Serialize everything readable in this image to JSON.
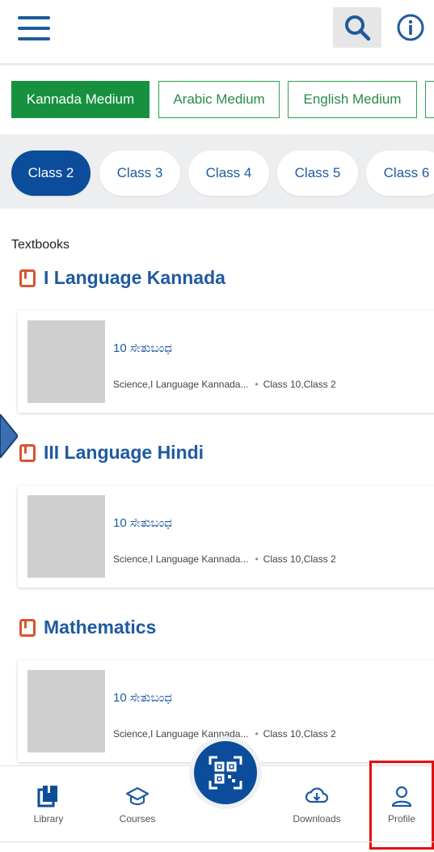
{
  "mediums": [
    {
      "label": "Kannada Medium",
      "active": true
    },
    {
      "label": "Arabic Medium",
      "active": false
    },
    {
      "label": "English Medium",
      "active": false
    }
  ],
  "classes": [
    {
      "label": "Class 2",
      "active": true
    },
    {
      "label": "Class 3",
      "active": false
    },
    {
      "label": "Class 4",
      "active": false
    },
    {
      "label": "Class 5",
      "active": false
    },
    {
      "label": "Class 6",
      "active": false
    }
  ],
  "section_label": "Textbooks",
  "subjects": [
    {
      "heading": "I Language Kannada",
      "card": {
        "title": "10 ಸೇತುಬಂಧ",
        "subjects_text": "Science,I Language Kannada...",
        "grades_text": "Class 10,Class 2"
      }
    },
    {
      "heading": "III Language Hindi",
      "card": {
        "title": "10 ಸೇತುಬಂಧ",
        "subjects_text": "Science,I Language Kannada...",
        "grades_text": "Class 10,Class 2"
      }
    },
    {
      "heading": "Mathematics",
      "card": {
        "title": "10 ಸೇತುಬಂಧ",
        "subjects_text": "Science,I Language Kannada...",
        "grades_text": "Class 10,Class 2"
      }
    }
  ],
  "bottom_nav": {
    "library": "Library",
    "courses": "Courses",
    "downloads": "Downloads",
    "profile": "Profile"
  },
  "colors": {
    "brand_blue": "#0b4d9a",
    "medium_green": "#17913f",
    "highlight_red": "#e01010"
  },
  "icons": [
    "menu-icon",
    "search-icon",
    "info-icon",
    "book-icon",
    "library-icon",
    "courses-icon",
    "qr-scan-icon",
    "download-icon",
    "profile-icon"
  ]
}
